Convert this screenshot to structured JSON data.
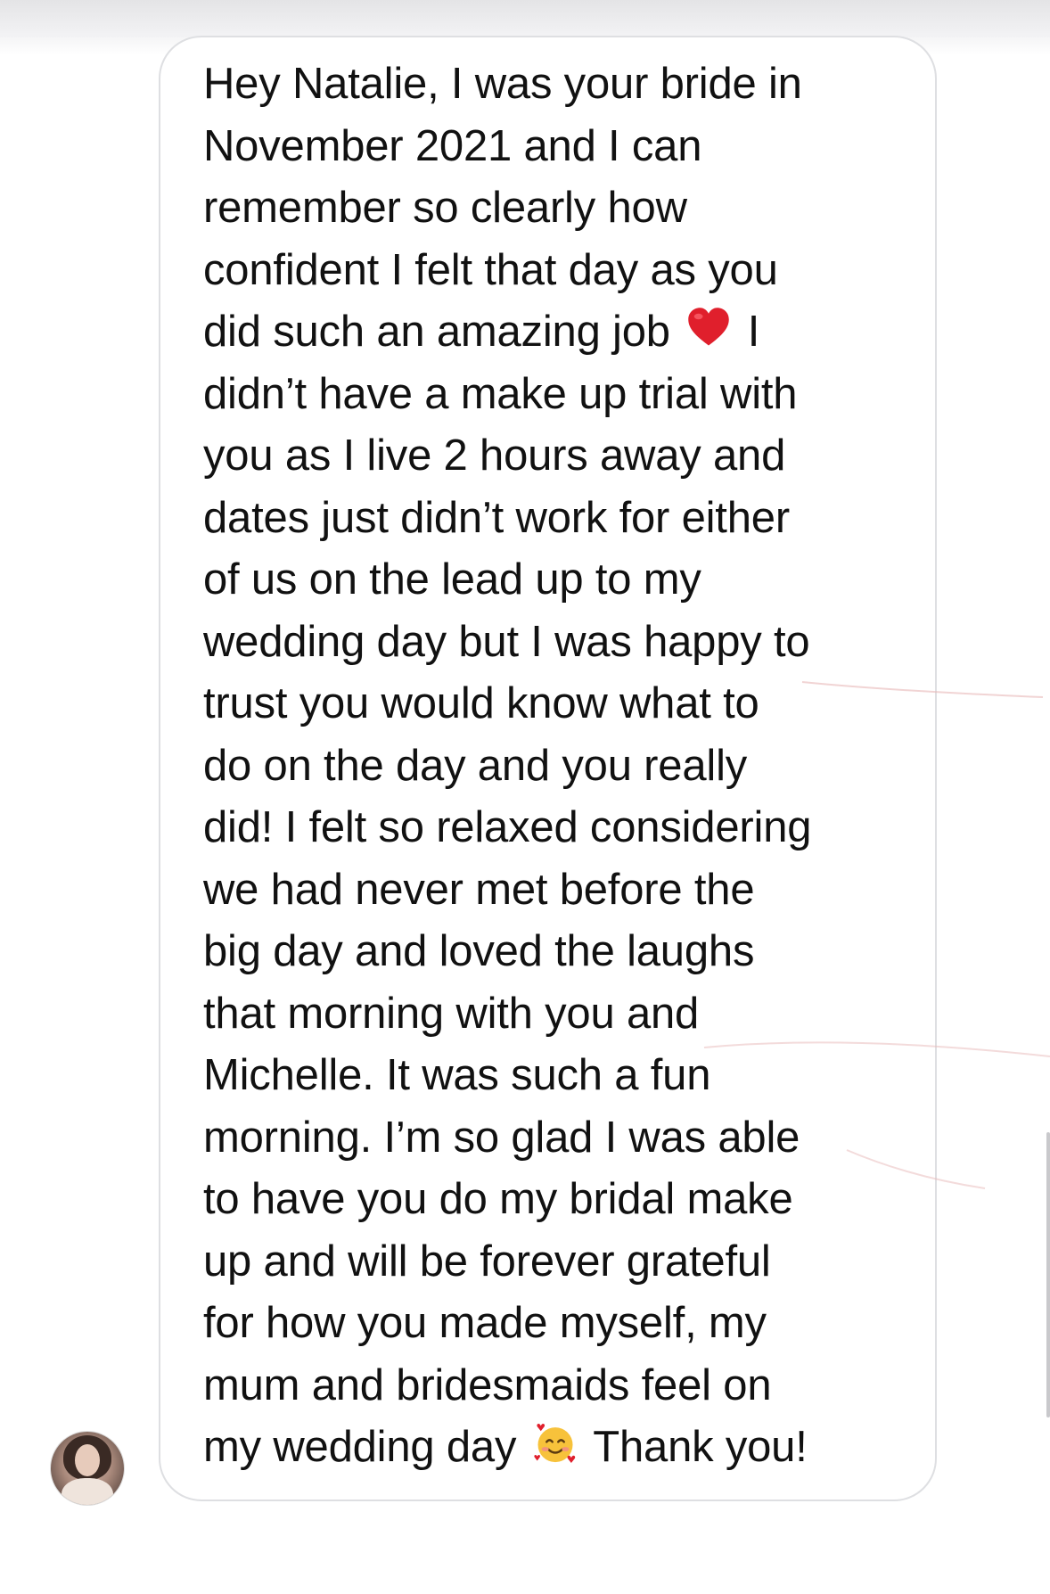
{
  "message": {
    "lines": [
      "Hey Natalie, I was your bride in",
      "November 2021 and I can",
      "remember so clearly how",
      "confident I felt that day as you",
      "did such an amazing job",
      "I",
      "didn’t have a make up trial with",
      "you as I live 2 hours away and",
      "dates just didn’t work for either",
      "of us on the lead up to my",
      "wedding day but I was happy to",
      "trust you would know what to",
      "do on the day and you really",
      "did! I felt so relaxed considering",
      "we had never met before the",
      "big day and loved the laughs",
      "that morning with you and",
      "Michelle. It was such a fun",
      "morning. I’m so glad I was able",
      "to have you do my bridal make",
      "up and will be forever grateful",
      "for how you made myself, my",
      "mum and bridesmaids feel on",
      "my wedding day",
      "Thank you!"
    ],
    "emojis": {
      "heart": "red-heart-icon",
      "smile": "smiling-face-with-hearts-icon"
    }
  },
  "colors": {
    "bubble_border": "#dedfe2",
    "text": "#111111",
    "background": "#ffffff",
    "heart": "#e01f2c",
    "smile_face": "#f7c23b"
  }
}
